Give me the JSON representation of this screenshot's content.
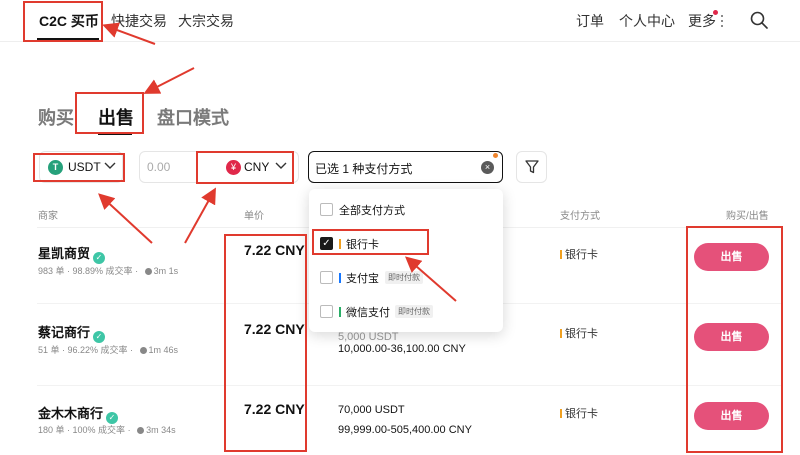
{
  "topnav": {
    "items": [
      "C2C 买币",
      "快捷交易",
      "大宗交易"
    ],
    "right": [
      "订单",
      "个人中心",
      "更多"
    ]
  },
  "modes": [
    "购买",
    "出售",
    "盘口模式"
  ],
  "filters": {
    "coin_icon": "T",
    "coin": "USDT",
    "amount_placeholder": "0.00",
    "fiat_icon": "¥",
    "fiat": "CNY",
    "payment_summary": "已选 1 种支付方式",
    "clear_icon": "×"
  },
  "columns": [
    "商家",
    "单价",
    "支付方式",
    "购买/出售"
  ],
  "rows": [
    {
      "merchant": "星凯商贸",
      "orders": "983 单",
      "rate": "98.89% 成交率",
      "time": "3m 1s",
      "price": "7.22 CNY",
      "quantity": "",
      "limit": "",
      "pay": "银行卡",
      "action": "出售"
    },
    {
      "merchant": "蔡记商行",
      "orders": "51 单",
      "rate": "96.22% 成交率",
      "time": "1m 46s",
      "price": "7.22 CNY",
      "quantity": "5,000 USDT",
      "limit": "10,000.00-36,100.00 CNY",
      "pay": "银行卡",
      "action": "出售"
    },
    {
      "merchant": "金木木商行",
      "orders": "180 单",
      "rate": "100% 成交率",
      "time": "3m 34s",
      "price": "7.22 CNY",
      "quantity": "70,000 USDT",
      "limit": "99,999.00-505,400.00 CNY",
      "pay": "银行卡",
      "action": "出售"
    }
  ],
  "dropdown": {
    "items": [
      {
        "label": "全部支付方式",
        "checked": false,
        "bar": "",
        "tag": ""
      },
      {
        "label": "银行卡",
        "checked": true,
        "bar": "#f0a020",
        "tag": ""
      },
      {
        "label": "支付宝",
        "checked": false,
        "bar": "#1677ff",
        "tag": "即时付款"
      },
      {
        "label": "微信支付",
        "checked": false,
        "bar": "#2aae67",
        "tag": "即时付款"
      }
    ]
  },
  "colors": {
    "sell": "#e5517a",
    "annotation": "#e03a2e",
    "verified": "#3ec6a6",
    "usdt": "#26a17b"
  }
}
